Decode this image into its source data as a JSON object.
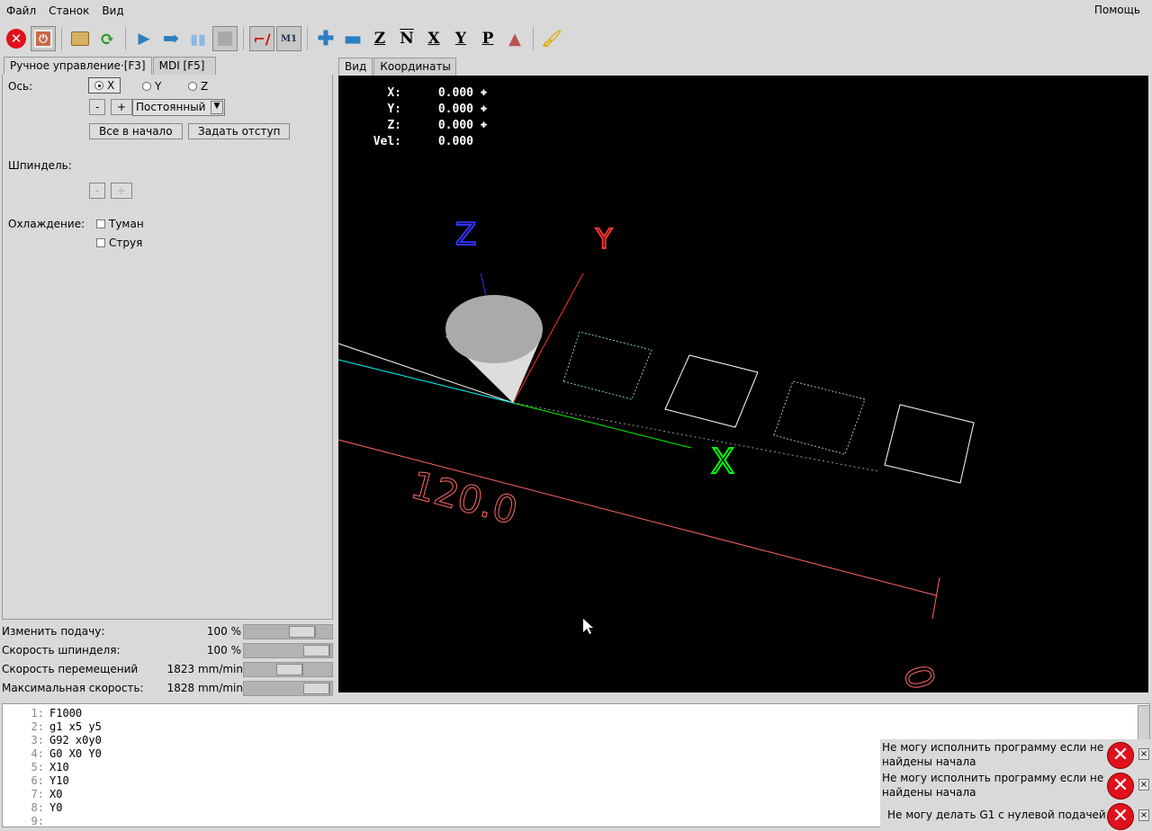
{
  "menu": {
    "items": [
      "Файл",
      "Станок",
      "Вид"
    ],
    "help": "Помощь"
  },
  "toolbar": {
    "icons": [
      "estop-icon",
      "power-icon",
      "open-file-icon",
      "reload-icon",
      "run-icon",
      "step-icon",
      "pause-icon",
      "stop-icon",
      "block-delete-icon",
      "optional-stop-icon",
      "zoom-in-icon",
      "zoom-out-icon",
      "view-z-icon",
      "view-z-rotated-icon",
      "view-x-icon",
      "view-y-icon",
      "view-perspective-icon",
      "rotate-view-icon",
      "clear-plot-icon"
    ],
    "m1_label": "M1",
    "z": "Z",
    "x": "X",
    "y": "Y",
    "p": "P"
  },
  "left_tabs": [
    {
      "label": "Ручное управление·[F3]",
      "active": true
    },
    {
      "label": "MDI [F5]",
      "active": false
    }
  ],
  "right_tabs": [
    {
      "label": "Вид",
      "active": true
    },
    {
      "label": "Координаты",
      "active": false
    }
  ],
  "manual": {
    "axis_label": "Ось:",
    "axes": [
      {
        "label": "X",
        "selected": true
      },
      {
        "label": "Y",
        "selected": false
      },
      {
        "label": "Z",
        "selected": false
      }
    ],
    "minus": "-",
    "plus": "+",
    "jog_mode": "Постоянный",
    "home_all": "Все в начало",
    "touch_off": "Задать отступ",
    "spindle_label": "Шпиндель:",
    "coolant_label": "Охлаждение:",
    "mist": "Туман",
    "flood": "Струя"
  },
  "sliders": [
    {
      "label": "Изменить подачу:",
      "value": "100 %",
      "fraction": 0.75
    },
    {
      "label": "Скорость шпинделя:",
      "value": "100 %",
      "fraction": 1.0
    },
    {
      "label": "Скорость перемещений",
      "value": "1823 mm/min",
      "fraction": 0.55
    },
    {
      "label": "Максимальная скорость:",
      "value": "1828 mm/min",
      "fraction": 1.0
    }
  ],
  "dro": [
    {
      "axis": "X:",
      "value": "0.000"
    },
    {
      "axis": "Y:",
      "value": "0.000"
    },
    {
      "axis": "Z:",
      "value": "0.000"
    },
    {
      "axis": "Vel:",
      "value": "0.000"
    }
  ],
  "view": {
    "axis_z": "Z",
    "axis_y": "Y",
    "axis_x": "X",
    "dimension": "120.0",
    "dimension2": "0."
  },
  "code": [
    {
      "n": "1:",
      "t": "F1000"
    },
    {
      "n": "2:",
      "t": "g1 x5 y5"
    },
    {
      "n": "3:",
      "t": "G92 x0y0"
    },
    {
      "n": "4:",
      "t": "G0 X0 Y0"
    },
    {
      "n": "5:",
      "t": "X10"
    },
    {
      "n": "6:",
      "t": "Y10"
    },
    {
      "n": "7:",
      "t": "X0"
    },
    {
      "n": "8:",
      "t": "Y0"
    },
    {
      "n": "9:",
      "t": ""
    }
  ],
  "errors": [
    "Не могу исполнить программу если не найдены начала",
    "Не могу исполнить программу если не найдены начала",
    "Не могу делать G1 с нулевой подачей"
  ],
  "colors": {
    "background": "#d9d9d9",
    "view_bg": "#000000",
    "estop": "#e0101c",
    "tool_blue": "#2a7fc0"
  }
}
